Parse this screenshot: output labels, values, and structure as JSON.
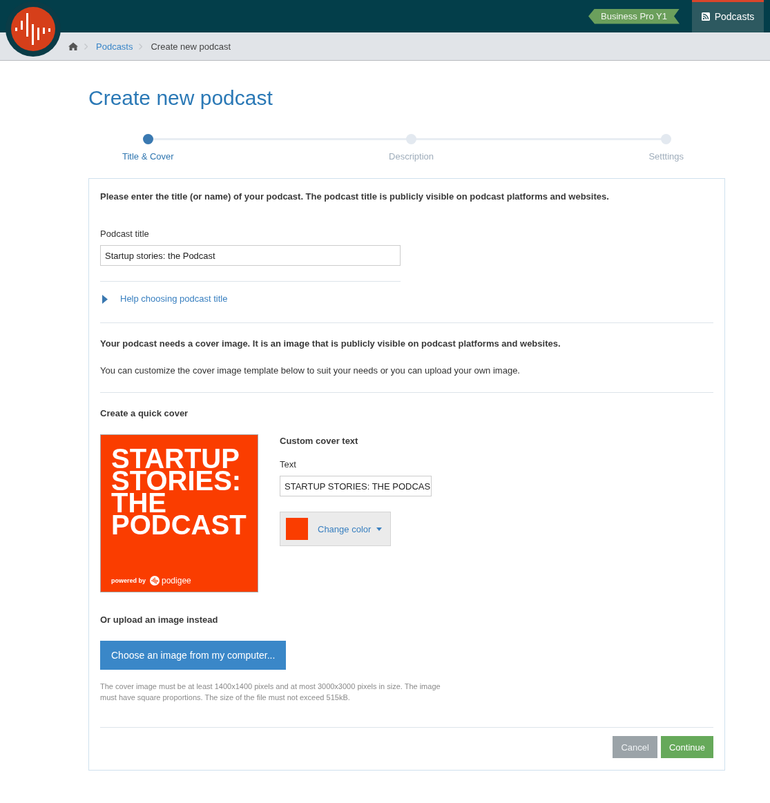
{
  "header": {
    "plan_badge": "Business Pro Y1",
    "nav": [
      {
        "label": "Podcasts",
        "selected": true
      }
    ]
  },
  "breadcrumb": [
    {
      "label": "Podcasts",
      "kind": "link"
    },
    {
      "label": "Create new podcast",
      "kind": "current"
    }
  ],
  "page_title": "Create new podcast",
  "steps": [
    {
      "label": "Title & Cover",
      "active": true
    },
    {
      "label": "Description",
      "active": false
    },
    {
      "label": "Setttings",
      "active": false
    }
  ],
  "title_section": {
    "intro": "Please enter the title (or name) of your podcast. The podcast title is publicly visible on podcast platforms and websites.",
    "field_label": "Podcast title",
    "field_value": "Startup stories: the Podcast",
    "help_link": "Help choosing podcast title",
    "help_expanded": false
  },
  "cover_section": {
    "intro_bold": "Your podcast needs a cover image. It is an image that is publicly visible on podcast platforms and websites.",
    "intro": "You can customize the cover image template below to suit your needs or you can upload your own image.",
    "quick_cover_heading": "Create a quick cover",
    "cover_text": "STARTUP STORIES: THE PODCAST",
    "powered_by": "powered by",
    "brand": "podigee",
    "color": "#fa3d00",
    "custom_heading": "Custom cover text",
    "text_label": "Text",
    "text_value": "STARTUP STORIES: THE PODCAS",
    "color_button": "Change color",
    "upload_heading": "Or upload an image instead",
    "upload_button": "Choose an image from my computer...",
    "upload_hint": "The cover image must be at least 1400x1400 pixels and at most 3000x3000 pixels in size. The image must have square proportions. The size of the file must not exceed 515kB."
  },
  "actions": [
    {
      "label": "Cancel",
      "kind": "secondary"
    },
    {
      "label": "Continue",
      "kind": "primary"
    }
  ]
}
